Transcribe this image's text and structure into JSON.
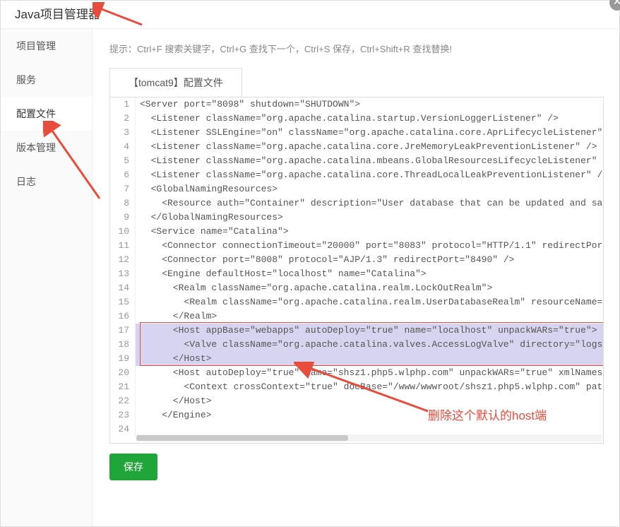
{
  "window": {
    "title": "Java项目管理器"
  },
  "sidebar": {
    "items": [
      {
        "label": "项目管理"
      },
      {
        "label": "服务"
      },
      {
        "label": "配置文件"
      },
      {
        "label": "版本管理"
      },
      {
        "label": "日志"
      }
    ],
    "active_index": 2
  },
  "hint": "提示：Ctrl+F 搜索关键字，Ctrl+G 查找下一个，Ctrl+S 保存，Ctrl+Shift+R 查找替换!",
  "tab": {
    "label": "【tomcat9】配置文件"
  },
  "code_lines": [
    "<Server port=\"8098\" shutdown=\"SHUTDOWN\">",
    "  <Listener className=\"org.apache.catalina.startup.VersionLoggerListener\" />",
    "  <Listener SSLEngine=\"on\" className=\"org.apache.catalina.core.AprLifecycleListener\" ",
    "  <Listener className=\"org.apache.catalina.core.JreMemoryLeakPreventionListener\" />",
    "  <Listener className=\"org.apache.catalina.mbeans.GlobalResourcesLifecycleListener\" /",
    "  <Listener className=\"org.apache.catalina.core.ThreadLocalLeakPreventionListener\" />",
    "  <GlobalNamingResources>",
    "    <Resource auth=\"Container\" description=\"User database that can be updated and sav",
    "  </GlobalNamingResources>",
    "  <Service name=\"Catalina\">",
    "    <Connector connectionTimeout=\"20000\" port=\"8083\" protocol=\"HTTP/1.1\" redirectPort=",
    "    <Connector port=\"8008\" protocol=\"AJP/1.3\" redirectPort=\"8490\" />",
    "    <Engine defaultHost=\"localhost\" name=\"Catalina\">",
    "      <Realm className=\"org.apache.catalina.realm.LockOutRealm\">",
    "        <Realm className=\"org.apache.catalina.realm.UserDatabaseRealm\" resourceName=\"U",
    "      </Realm>",
    "      <Host appBase=\"webapps\" autoDeploy=\"true\" name=\"localhost\" unpackWARs=\"true\">",
    "        <Valve className=\"org.apache.catalina.valves.AccessLogValve\" directory=\"logs\" ",
    "      </Host>",
    "      <Host autoDeploy=\"true\" name=\"shsz1.php5.wlphp.com\" unpackWARs=\"true\" xmlNamespa",
    "        <Context crossContext=\"true\" docBase=\"/www/wwwroot/shsz1.php5.wlphp.com\" path=",
    "      </Host>",
    "    </Engine>",
    ""
  ],
  "highlight_lines": [
    17,
    18,
    19
  ],
  "annotation": "删除这个默认的host端",
  "save_button": "保存",
  "colors": {
    "accent": "#20a53a",
    "arrow": "#e74c3c",
    "highlight": "#d7d4f0"
  }
}
